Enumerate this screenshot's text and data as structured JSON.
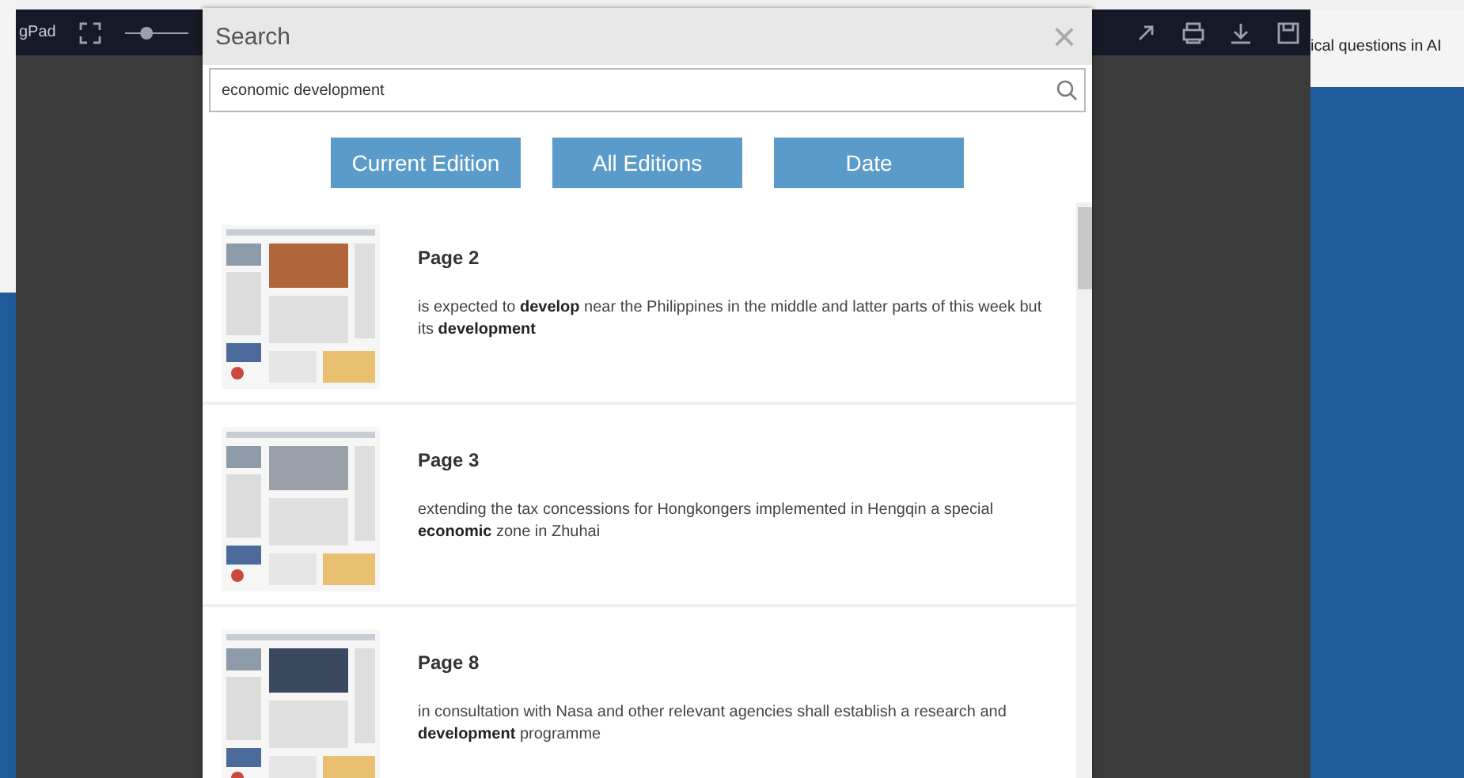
{
  "toolbar": {
    "title": "gPad",
    "zoom": {
      "level": 0.3
    }
  },
  "side_text": "ical questions in AI",
  "dialog": {
    "title": "Search",
    "close": "×",
    "search": {
      "value": "economic development"
    },
    "filters": [
      {
        "label": "Current Edition"
      },
      {
        "label": "All Editions"
      },
      {
        "label": "Date"
      }
    ],
    "results": [
      {
        "page": "Page 2",
        "snippet": "is expected to **develop** near the Philippines in the middle and latter parts of this week but its **development**"
      },
      {
        "page": "Page 3",
        "snippet": "extending the tax concessions for Hongkongers implemented in Hengqin a special **economic** zone in Zhuhai"
      },
      {
        "page": "Page 8",
        "snippet": "in consultation with Nasa and other relevant agencies shall establish a research and **development** programme"
      }
    ]
  }
}
